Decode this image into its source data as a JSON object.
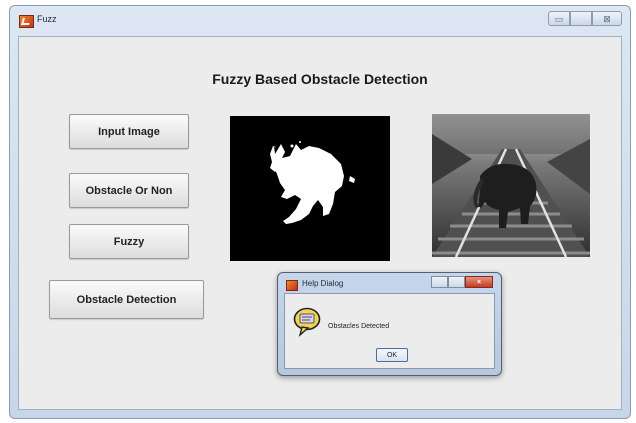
{
  "window": {
    "title": "Fuzz",
    "controls": {
      "minimize": "▭",
      "maximize": "",
      "close": "⊠"
    }
  },
  "main": {
    "heading": "Fuzzy Based Obstacle Detection",
    "buttons": {
      "input_image": "Input Image",
      "obstacle_or_non": "Obstacle Or Non",
      "fuzzy": "Fuzzy",
      "obstacle_detection": "Obstacle Detection"
    },
    "images": {
      "mask": "binary-elephant-mask",
      "photo": "elephant-on-railway-track"
    }
  },
  "dialog": {
    "title": "Help Dialog",
    "message": "Obstacles Detected",
    "ok_label": "OK",
    "icon": "help-speech-bubble-icon"
  }
}
